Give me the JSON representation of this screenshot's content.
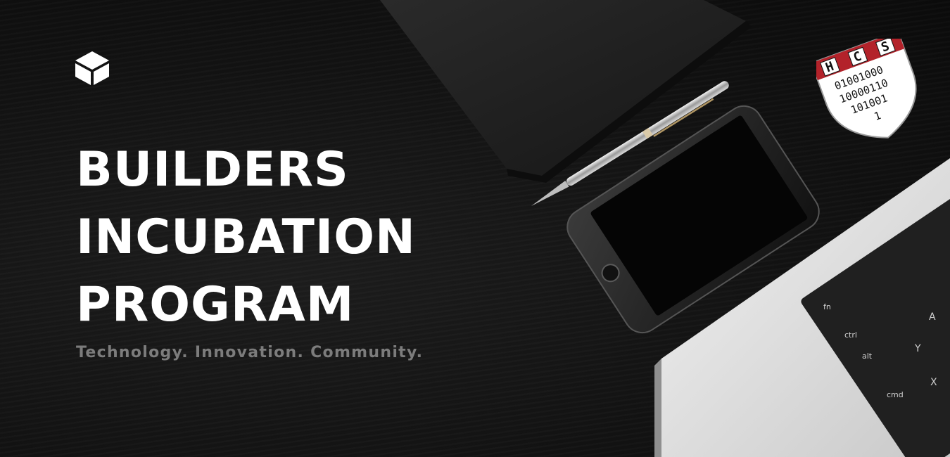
{
  "banner": {
    "headline": [
      "BUILDERS",
      "INCUBATION",
      "PROGRAM"
    ],
    "tagline": "Technology. Innovation. Community."
  },
  "logos": {
    "left_logo": "cube-icon",
    "right_logo": {
      "letters": [
        "H",
        "C",
        "S"
      ],
      "binary_lines": [
        "01001000",
        "10000110",
        "101001",
        "1"
      ]
    }
  },
  "keyboard": {
    "keys": [
      "fn",
      "ctrl",
      "alt",
      "cmd",
      "A",
      "Y",
      "X"
    ]
  },
  "colors": {
    "background": "#151515",
    "headline": "#ffffff",
    "tagline": "#7c7c7c",
    "shield_red": "#b3222a"
  }
}
